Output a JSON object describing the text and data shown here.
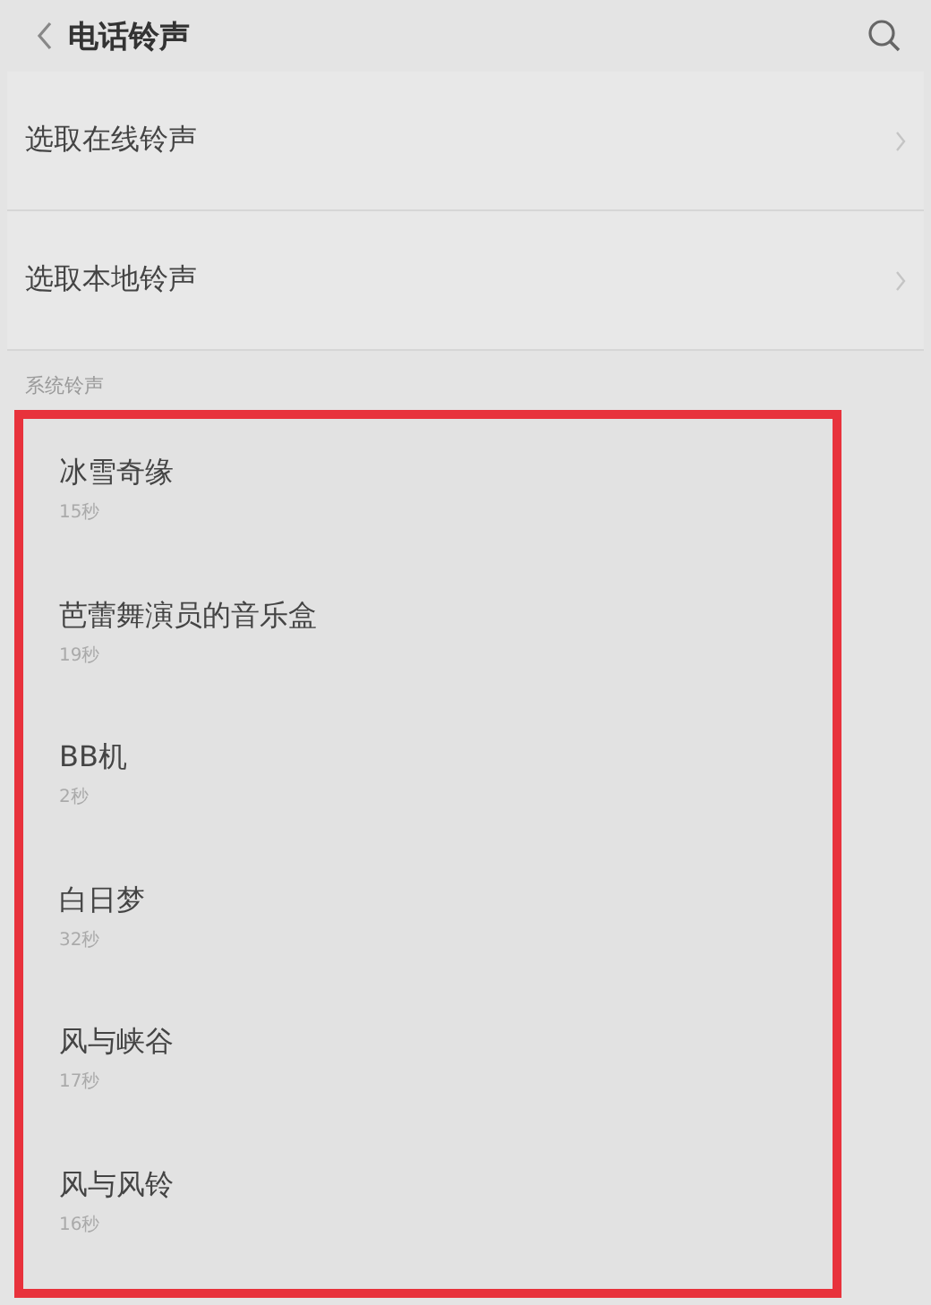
{
  "header": {
    "title": "电话铃声"
  },
  "options": [
    {
      "label": "选取在线铃声"
    },
    {
      "label": "选取本地铃声"
    }
  ],
  "section": {
    "title": "系统铃声",
    "highlighted": true,
    "ringtones": [
      {
        "name": "冰雪奇缘",
        "duration": "15秒"
      },
      {
        "name": "芭蕾舞演员的音乐盒",
        "duration": "19秒"
      },
      {
        "name": "BB机",
        "duration": "2秒"
      },
      {
        "name": "白日梦",
        "duration": "32秒"
      },
      {
        "name": "风与峡谷",
        "duration": "17秒"
      },
      {
        "name": "风与风铃",
        "duration": "16秒"
      }
    ]
  }
}
